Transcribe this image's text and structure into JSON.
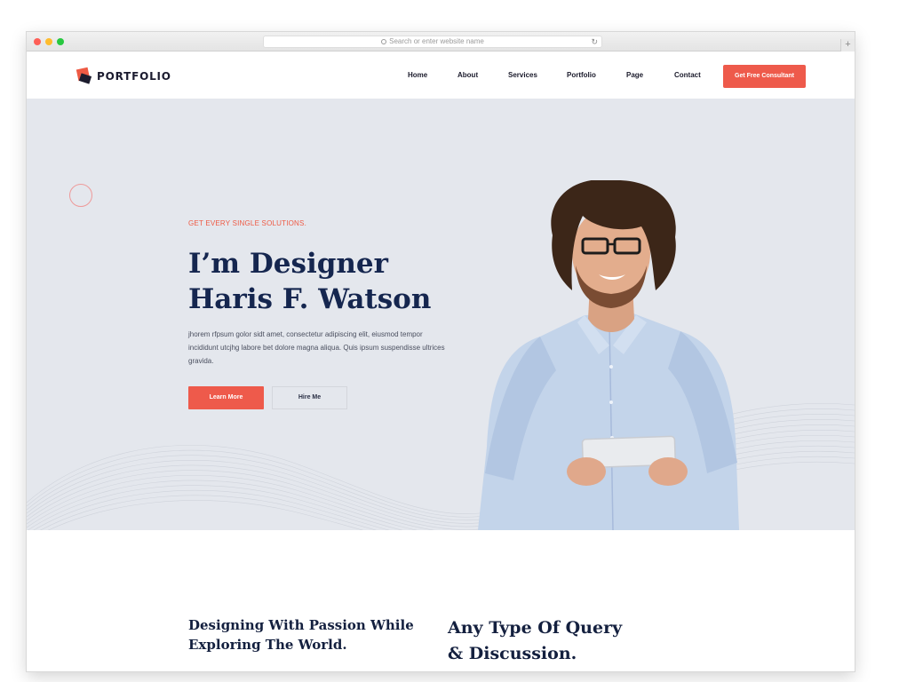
{
  "browser": {
    "url_placeholder": "Search or enter website name",
    "reload_icon": "reload-icon",
    "new_tab_icon": "plus-icon"
  },
  "nav": {
    "logo_text": "PORTFOLIO",
    "menu": [
      "Home",
      "About",
      "Services",
      "Portfolio",
      "Page",
      "Contact"
    ],
    "cta_label": "Get Free Consultant"
  },
  "hero": {
    "eyebrow": "GET EVERY SINGLE SOLUTIONS.",
    "headline_line1": "I’m Designer",
    "headline_line2": "Haris F. Watson",
    "description": "jhorem rfpsum golor sidt amet, consectetur adipiscing elit, eiusmod tempor incididunt utcjhg labore bet dolore magna aliqua. Quis ipsum suspendisse ultrices gravida.",
    "learn_more_label": "Learn More",
    "hire_me_label": "Hire Me"
  },
  "lower": {
    "left_line1": "Designing With Passion While",
    "left_line2": "Exploring The World.",
    "right_line1": "Any Type Of Query",
    "right_line2": "& Discussion."
  },
  "colors": {
    "accent": "#ee5a4b",
    "navy": "#15264f",
    "hero_bg": "#e4e7ed"
  }
}
